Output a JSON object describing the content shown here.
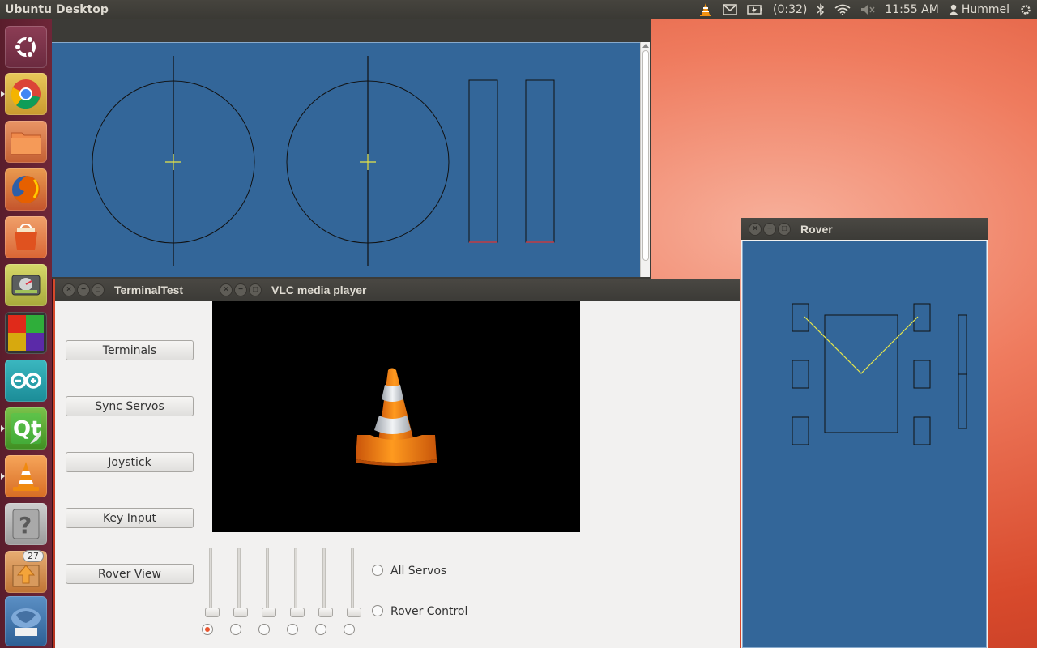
{
  "panel": {
    "title": "Ubuntu Desktop",
    "battery": "(0:32)",
    "clock": "11:55 AM",
    "user": "Hummel",
    "icons": [
      "vlc-tray-icon",
      "mail-icon",
      "battery-icon",
      "bluetooth-icon",
      "wifi-icon",
      "volume-muted-icon",
      "user-icon",
      "power-gear-icon"
    ]
  },
  "launcher": {
    "items": [
      {
        "name": "ubuntu-dash",
        "icon": "ubuntu-logo-icon"
      },
      {
        "name": "chrome",
        "icon": "chrome-icon"
      },
      {
        "name": "files",
        "icon": "folder-icon"
      },
      {
        "name": "firefox",
        "icon": "firefox-icon"
      },
      {
        "name": "software-center",
        "icon": "shopping-bag-icon"
      },
      {
        "name": "disk-utility",
        "icon": "disk-icon"
      },
      {
        "name": "workspaces",
        "icon": "workspace-switcher-icon"
      },
      {
        "name": "arduino",
        "icon": "arduino-icon"
      },
      {
        "name": "qt-creator",
        "icon": "qt-icon"
      },
      {
        "name": "vlc",
        "icon": "vlc-icon"
      },
      {
        "name": "help",
        "icon": "question-icon"
      },
      {
        "name": "update-manager",
        "icon": "update-icon",
        "badge": "27"
      },
      {
        "name": "trash",
        "icon": "trash-icon"
      }
    ]
  },
  "terminal_test": {
    "title": "TerminalTest",
    "buttons": [
      "Terminals",
      "Sync Servos",
      "Joystick",
      "Key Input",
      "Rover View"
    ],
    "options": [
      "All Servos",
      "Rover Control"
    ],
    "servo_slider_count": 6
  },
  "vlc": {
    "title": "VLC media player"
  },
  "rover": {
    "title": "Rover"
  },
  "colors": {
    "canvas": "#336699",
    "crosshair": "#e6e64a",
    "accent": "#e9552f"
  }
}
